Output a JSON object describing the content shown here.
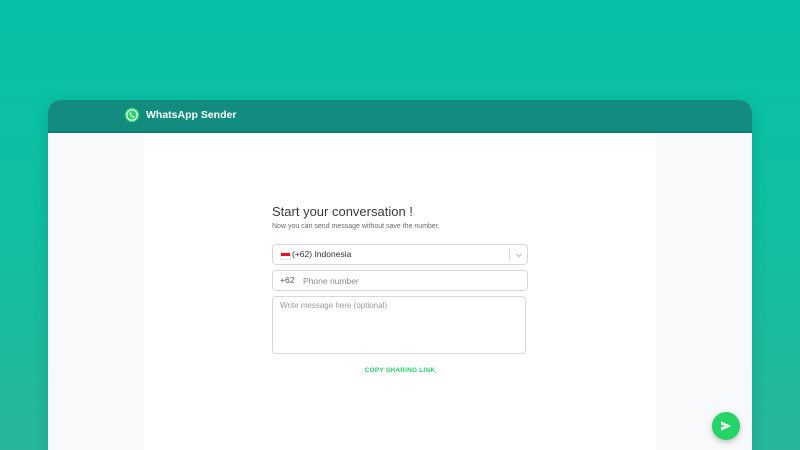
{
  "app": {
    "title": "WhatsApp Sender",
    "logo_icon": "whatsapp-logo-icon",
    "header_color": "#128c7e",
    "accent_color": "#25d366"
  },
  "form": {
    "heading": "Start your conversation !",
    "subtext": "Now you can send message without save the number.",
    "country_select": {
      "flag_icon": "indonesia-flag-icon",
      "selected": "(+62) Indonesia",
      "dropdown_icon": "chevron-down-icon"
    },
    "phone": {
      "dial_code": "+62",
      "placeholder": "Phone number",
      "value": ""
    },
    "message": {
      "placeholder": "Write message here (optional)",
      "value": ""
    },
    "copy_link_label": "COPY SHARING LINK"
  },
  "fab": {
    "icon": "send-icon"
  }
}
